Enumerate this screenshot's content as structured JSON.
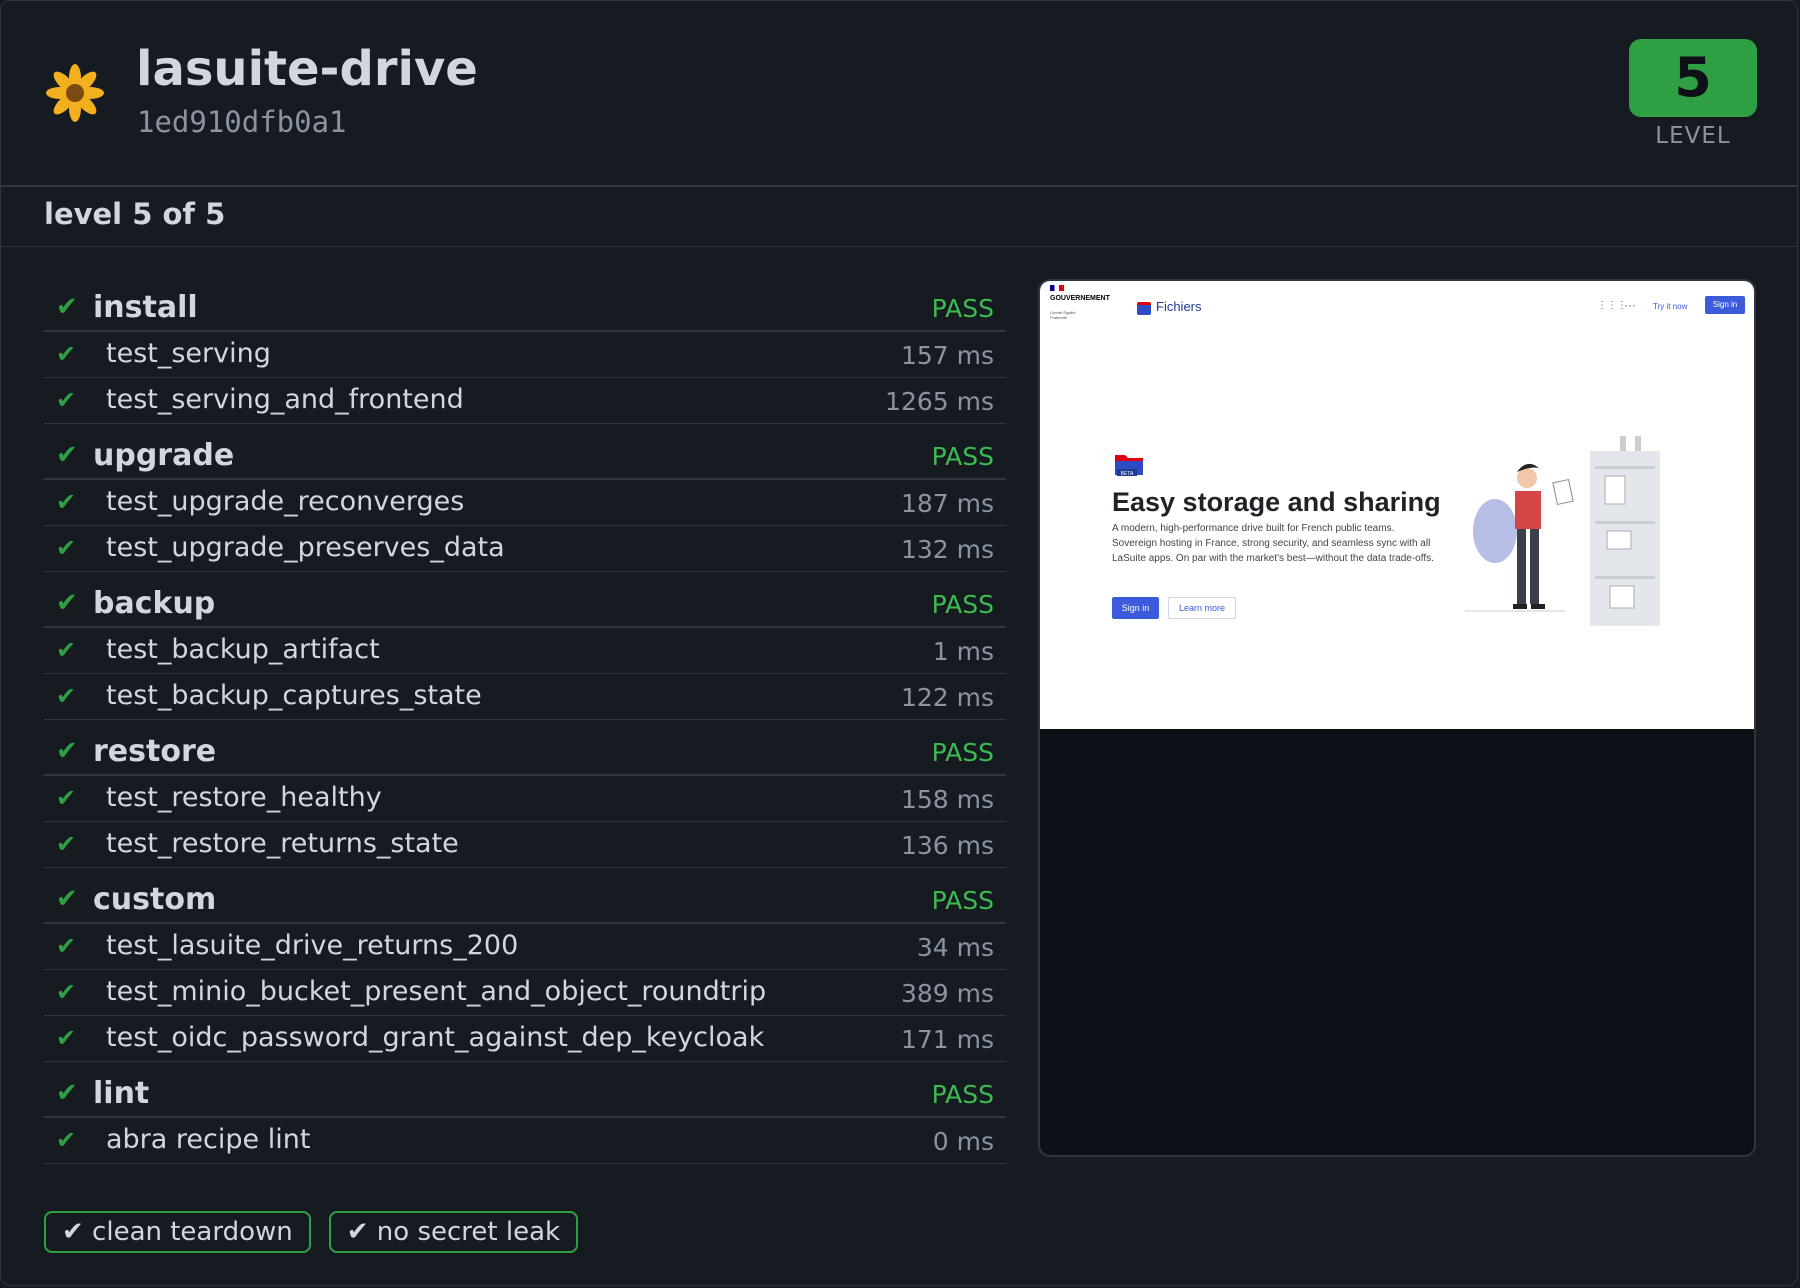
{
  "header": {
    "project": "lasuite-drive",
    "commit": "1ed910dfb0a1",
    "level_value": "5",
    "level_label": "LEVEL"
  },
  "level_summary": "level 5 of 5",
  "check_glyph": "✔",
  "groups": [
    {
      "name": "install",
      "status": "PASS",
      "tests": [
        {
          "name": "test_serving",
          "duration": "157 ms"
        },
        {
          "name": "test_serving_and_frontend",
          "duration": "1265 ms"
        }
      ]
    },
    {
      "name": "upgrade",
      "status": "PASS",
      "tests": [
        {
          "name": "test_upgrade_reconverges",
          "duration": "187 ms"
        },
        {
          "name": "test_upgrade_preserves_data",
          "duration": "132 ms"
        }
      ]
    },
    {
      "name": "backup",
      "status": "PASS",
      "tests": [
        {
          "name": "test_backup_artifact",
          "duration": "1 ms"
        },
        {
          "name": "test_backup_captures_state",
          "duration": "122 ms"
        }
      ]
    },
    {
      "name": "restore",
      "status": "PASS",
      "tests": [
        {
          "name": "test_restore_healthy",
          "duration": "158 ms"
        },
        {
          "name": "test_restore_returns_state",
          "duration": "136 ms"
        }
      ]
    },
    {
      "name": "custom",
      "status": "PASS",
      "tests": [
        {
          "name": "test_lasuite_drive_returns_200",
          "duration": "34 ms"
        },
        {
          "name": "test_minio_bucket_present_and_object_roundtrip",
          "duration": "389 ms"
        },
        {
          "name": "test_oidc_password_grant_against_dep_keycloak",
          "duration": "171 ms"
        }
      ]
    },
    {
      "name": "lint",
      "status": "PASS",
      "tests": [
        {
          "name": "abra recipe lint",
          "duration": "0 ms"
        }
      ]
    }
  ],
  "screenshot": {
    "gov_label": "GOUVERNEMENT",
    "gov_motto": "Liberté Égalité Fraternité",
    "brand": "Fichiers",
    "try_label": "Try it now",
    "signin_top": "Sign in",
    "beta": "BETA",
    "hero_title": "Easy storage and sharing",
    "hero_desc": "A modern, high-performance drive built for French public teams. Sovereign hosting in France, strong security, and seamless sync with all LaSuite apps. On par with the market's best—without the data trade-offs.",
    "btn_signin": "Sign in",
    "btn_learn": "Learn more"
  },
  "chips": [
    "✔ clean teardown",
    "✔ no secret leak"
  ],
  "colors": {
    "background": "#161b22",
    "pass": "#3fb950",
    "badge": "#2ea043",
    "border": "#30363d"
  }
}
